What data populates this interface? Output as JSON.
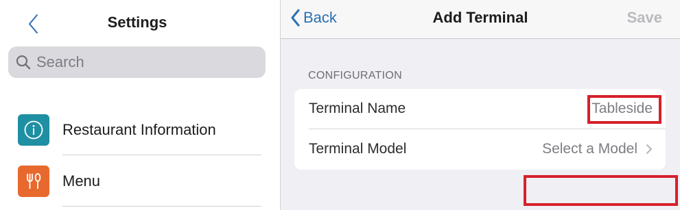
{
  "sidebar": {
    "title": "Settings",
    "search": {
      "placeholder": "Search",
      "value": ""
    },
    "items": [
      {
        "label": "Restaurant Information",
        "icon": "info-icon",
        "color": "#1f8fa3"
      },
      {
        "label": "Menu",
        "icon": "cutlery-icon",
        "color": "#e8692e"
      }
    ]
  },
  "detail": {
    "back_label": "Back",
    "title": "Add Terminal",
    "save_label": "Save",
    "section_header": "CONFIGURATION",
    "rows": [
      {
        "label": "Terminal Name",
        "value": "Tableside"
      },
      {
        "label": "Terminal Model",
        "value": "Select a Model"
      }
    ]
  },
  "colors": {
    "accent": "#2a6fb3",
    "highlight": "#d6202b",
    "disabled": "#b9b9be"
  }
}
